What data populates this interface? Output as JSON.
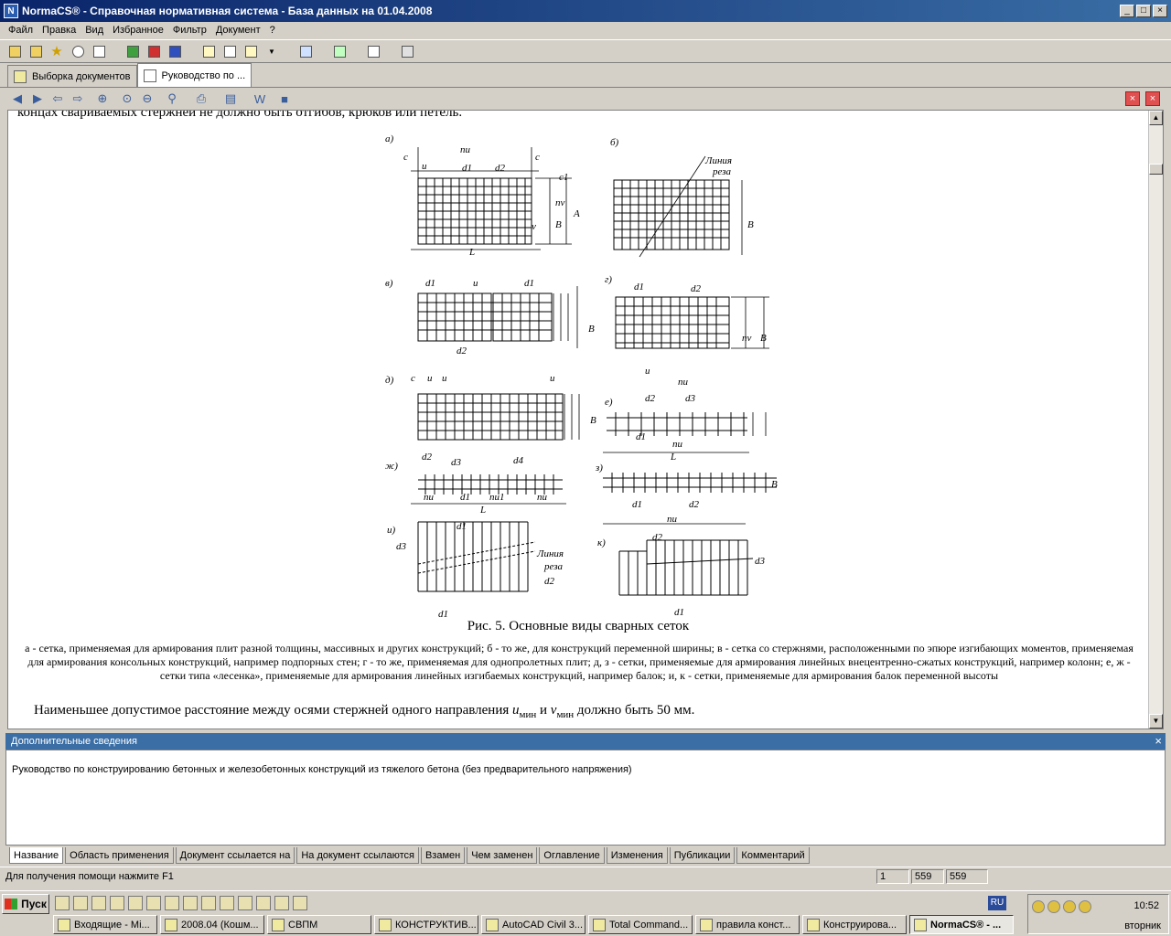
{
  "window": {
    "title": "NormaCS® - Справочная нормативная система - База данных на 01.04.2008",
    "app_icon": "N"
  },
  "menu": [
    "Файл",
    "Правка",
    "Вид",
    "Избранное",
    "Фильтр",
    "Документ",
    "?"
  ],
  "doc_tabs": [
    {
      "label": "Выборка документов"
    },
    {
      "label": "Руководство по ..."
    }
  ],
  "document": {
    "clipped_line": "концах свариваемых стержней не должно быть отгибов, крюков или петель.",
    "figure_labels": {
      "a": "а)",
      "b": "б)",
      "v": "в)",
      "g": "г)",
      "d": "д)",
      "e": "е)",
      "zh": "ж)",
      "z": "з)",
      "i": "и)",
      "k": "к)",
      "nu": "nu",
      "nv": "nv",
      "L": "L",
      "B": "B",
      "A": "A",
      "c": "c",
      "c1": "c1",
      "u": "u",
      "v_": "v",
      "d1": "d1",
      "d2": "d2",
      "d3": "d3",
      "d4": "d4",
      "nu1": "nu1",
      "cut_line_1": "Линия",
      "cut_line_2": "реза"
    },
    "caption": "Рис. 5. Основные виды сварных сеток",
    "legend": "а - сетка, применяемая для армирования плит разной толщины, массивных и других конструкций; б - то же, для конструкций переменной ширины; в - сетка со стержнями, расположенными по эпюре изгибающих моментов, применяемая для армирования консольных конструкций, например подпорных стен; г - то же, применяемая для однопролетных плит; д, з - сетки, применяемые для армирования линейных внецентренно-сжатых конструкций, например колонн; е, ж - сетки типа «лесенка», применяемые для армирования линейных изгибаемых конструкций, например балок; и, к - сетки, применяемые для армирования балок переменной высоты",
    "paragraph_start": "Наименьшее допустимое расстояние между осями стержней одного направления ",
    "u_sym": "u",
    "sub_min": "мин",
    "and": " и ",
    "v_sym": "v",
    "paragraph_end": " должно быть 50 мм."
  },
  "info_panel": {
    "header": "Дополнительные сведения",
    "text": "Руководство по конструированию бетонных и железобетонных конструкций из тяжелого бетона (без предварительного напряжения)",
    "tabs": [
      "Название",
      "Область применения",
      "Документ ссылается на",
      "На документ ссылаются",
      "Взамен",
      "Чем заменен",
      "Оглавление",
      "Изменения",
      "Публикации",
      "Комментарий"
    ]
  },
  "status": {
    "message": "Для получения помощи нажмите F1",
    "cells": [
      "1",
      "559",
      "559"
    ]
  },
  "taskbar": {
    "start": "Пуск",
    "lang": "RU",
    "time": "10:52",
    "day": "вторник",
    "tasks": [
      "Входящие - Mi...",
      "2008.04 (Кошм...",
      "СВПМ",
      "КОНСТРУКТИВ...",
      "AutoCAD Civil 3...",
      "Total Command...",
      "правила конст...",
      "Конструирова...",
      "NormaCS® - ..."
    ]
  }
}
